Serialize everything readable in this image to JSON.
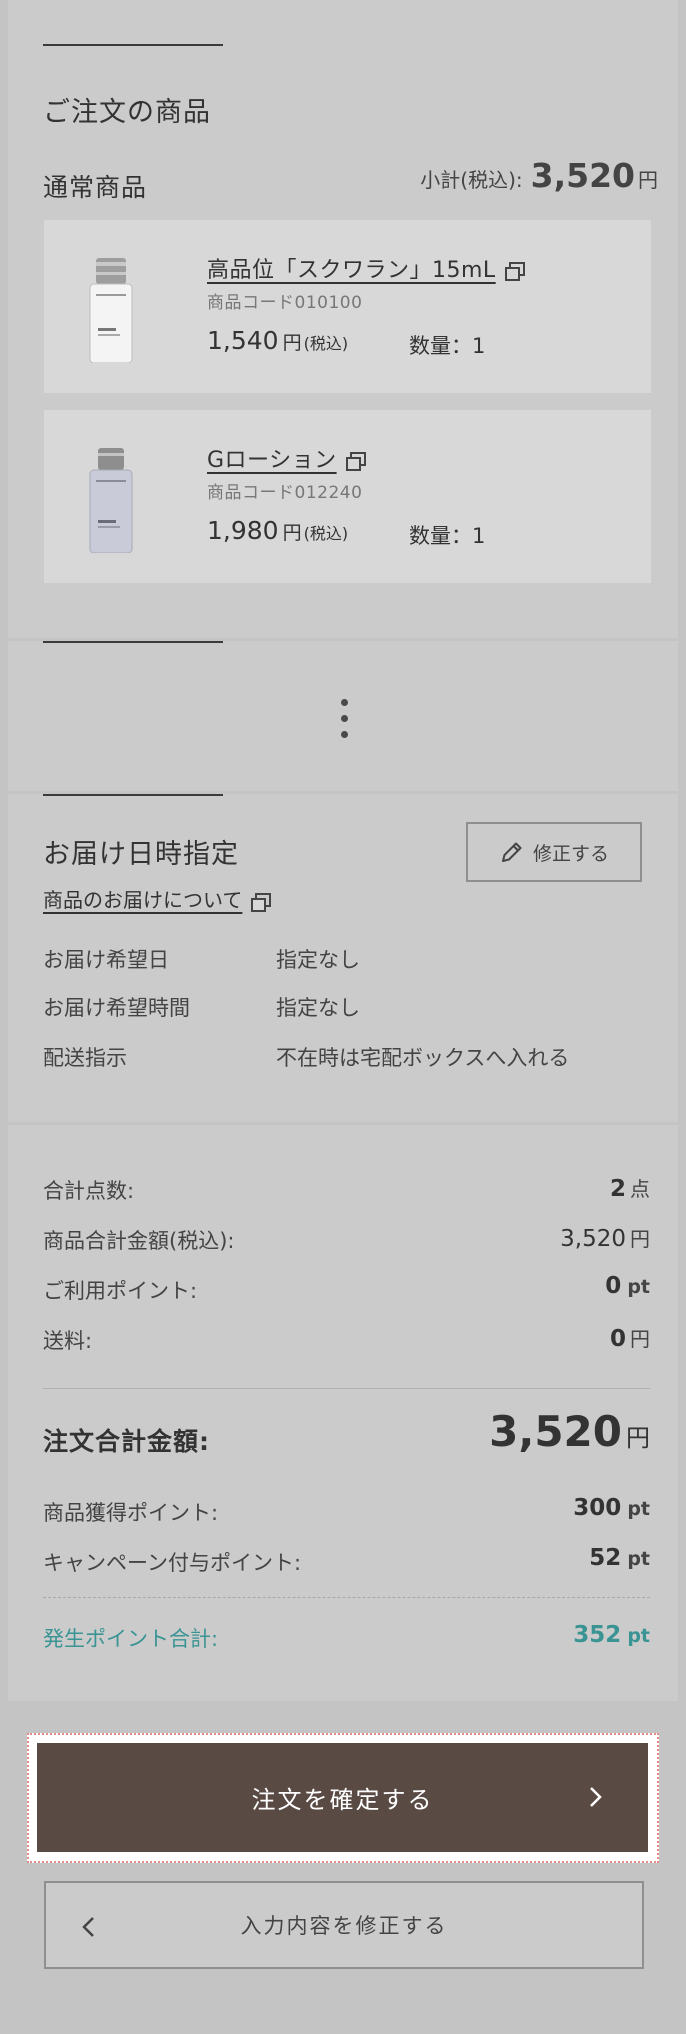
{
  "order": {
    "title": "ご注文の商品",
    "group_title": "通常商品",
    "subtotal_label": "小計(税込):",
    "subtotal_amount": "3,520",
    "subtotal_unit": "円",
    "products": [
      {
        "name": "高品位「スクワラン」15mL",
        "code": "商品コード010100",
        "price": "1,540",
        "price_unit": "円",
        "tax_note": "(税込)",
        "qty": "数量：1"
      },
      {
        "name": "Gローション",
        "code": "商品コード012240",
        "price": "1,980",
        "price_unit": "円",
        "tax_note": "(税込)",
        "qty": "数量：1"
      }
    ]
  },
  "delivery": {
    "title": "お届け日時指定",
    "edit_label": "修正する",
    "link_label": "商品のお届けについて",
    "rows": [
      {
        "label": "お届け希望日",
        "value": "指定なし"
      },
      {
        "label": "お届け希望時間",
        "value": "指定なし"
      },
      {
        "label": "配送指示",
        "value": "不在時は宅配ボックスへ入れる"
      }
    ]
  },
  "totals": {
    "count_label": "合計点数:",
    "count_value": "2",
    "count_unit": "点",
    "goods_label": "商品合計金額(税込):",
    "goods_value": "3,520",
    "goods_unit": "円",
    "points_used_label": "ご利用ポイント:",
    "points_used_value": "0",
    "points_used_unit": "pt",
    "shipping_label": "送料:",
    "shipping_value": "0",
    "shipping_unit": "円",
    "grand_label": "注文合計金額:",
    "grand_value": "3,520",
    "grand_unit": "円",
    "earn_label": "商品獲得ポイント:",
    "earn_value": "300",
    "earn_unit": "pt",
    "campaign_label": "キャンペーン付与ポイント:",
    "campaign_value": "52",
    "campaign_unit": "pt",
    "total_pt_label": "発生ポイント合計:",
    "total_pt_value": "352",
    "total_pt_unit": "pt"
  },
  "actions": {
    "confirm_label": "注文を確定する",
    "back_label": "入力内容を修正する"
  },
  "colors": {
    "accent_teal": "#3a9494",
    "confirm_bg": "#5a4a44",
    "page_bg": "#c4c4c4",
    "panel_bg": "#cbcbcb"
  }
}
